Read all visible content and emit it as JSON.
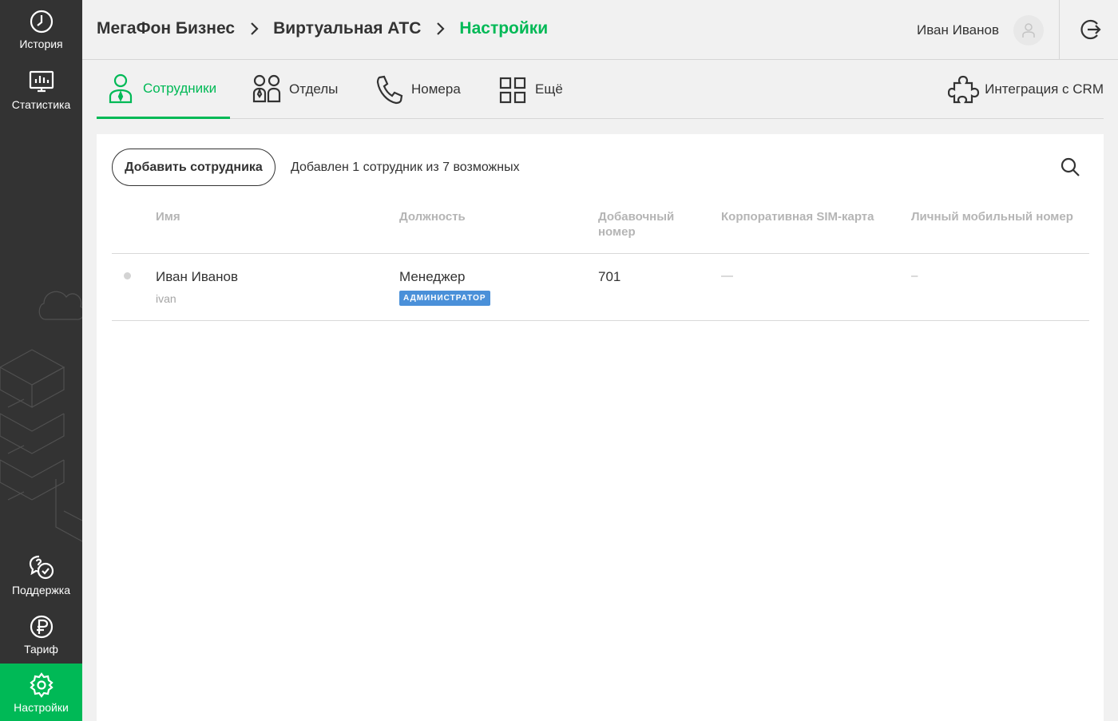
{
  "sidebar": {
    "items": [
      {
        "label": "История",
        "icon": "clock-icon"
      },
      {
        "label": "Статистика",
        "icon": "monitor-chart-icon"
      },
      {
        "label": "Поддержка",
        "icon": "support-chat-icon"
      },
      {
        "label": "Тариф",
        "icon": "ruble-icon"
      },
      {
        "label": "Настройки",
        "icon": "gear-icon",
        "active": true
      }
    ]
  },
  "header": {
    "breadcrumb": [
      "МегаФон Бизнес",
      "Виртуальная АТС",
      "Настройки"
    ],
    "user_name": "Иван Иванов"
  },
  "tabs": [
    {
      "label": "Сотрудники",
      "active": true
    },
    {
      "label": "Отделы"
    },
    {
      "label": "Номера"
    },
    {
      "label": "Ещё"
    },
    {
      "label": "Интеграция с CRM"
    }
  ],
  "toolbar": {
    "add_label": "Добавить сотрудника",
    "added_info": "Добавлен 1 сотрудник из 7 возможных"
  },
  "table": {
    "columns": [
      "Имя",
      "Должность",
      "Добавочный номер",
      "Корпоративная SIM-карта",
      "Личный мобильный номер"
    ],
    "rows": [
      {
        "name": "Иван Иванов",
        "login": "ivan",
        "position": "Менеджер",
        "role": "АДМИНИСТРАТОР",
        "extension": "701",
        "sim": "—",
        "mobile": "–"
      }
    ]
  },
  "colors": {
    "accent": "#00b956",
    "sidebar": "#333333",
    "badge": "#4a90d9"
  }
}
